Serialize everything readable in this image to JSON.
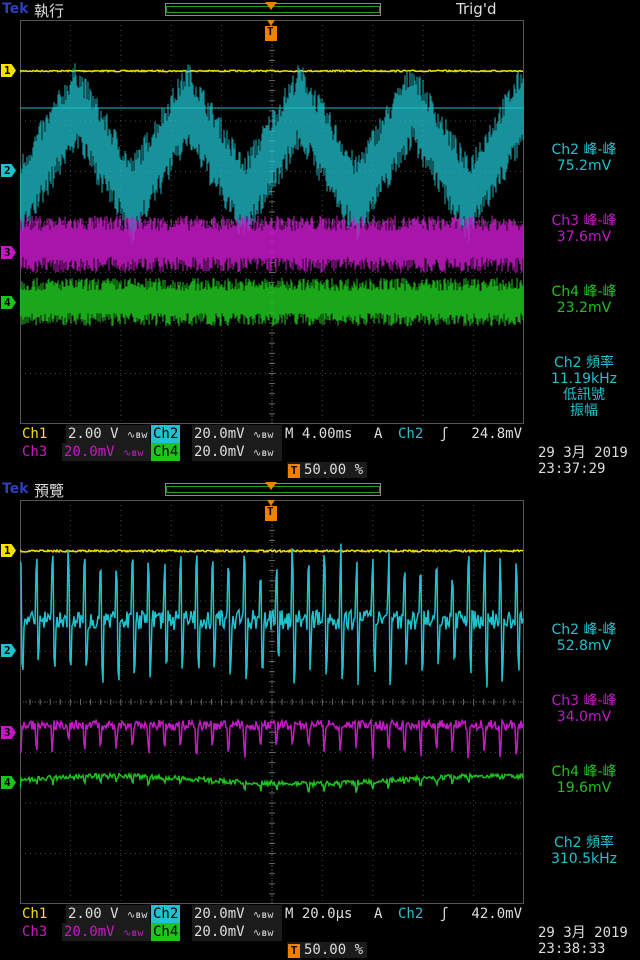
{
  "panels": [
    {
      "brand": "Tek",
      "mode": "執行",
      "trigger_status": "Trig'd",
      "channel_markers": [
        "1",
        "2",
        "3",
        "4"
      ],
      "trigger_marker": "T",
      "measurements": [
        {
          "label": "Ch2 峰-峰",
          "value": "75.2mV",
          "color": "#1fc3cf"
        },
        {
          "label": "Ch3 峰-峰",
          "value": "37.6mV",
          "color": "#c41ac6"
        },
        {
          "label": "Ch4 峰-峰",
          "value": "23.2mV",
          "color": "#1ec41e"
        },
        {
          "label": "Ch2 頻率",
          "value": "11.19kHz",
          "note1": "低訊號",
          "note2": "振幅",
          "color": "#1fc3cf"
        }
      ],
      "settings": {
        "ch1_label": "Ch1",
        "ch1_scale": "2.00 V",
        "ch2_label": "Ch2",
        "ch2_scale": "20.0mV",
        "ch3_label": "Ch3",
        "ch3_scale": "20.0mV",
        "ch4_label": "Ch4",
        "ch4_scale": "20.0mV",
        "bw_symbol": "∿ʙw",
        "timebase": "M 4.00ms",
        "acq": "A",
        "trig_source": "Ch2",
        "trig_slope": "ʃ",
        "trig_level": "24.8mV",
        "trig_position": "50.00 %"
      },
      "date": "29 3月  2019",
      "time": "23:37:29",
      "waveform": {
        "ch2_shape": "triangle-noisy",
        "ch2_cycles": 4.5,
        "ch2_freq_text": "11.19kHz"
      }
    },
    {
      "brand": "Tek",
      "mode": "預覽",
      "trigger_status": "",
      "channel_markers": [
        "1",
        "2",
        "3",
        "4"
      ],
      "trigger_marker": "T",
      "measurements": [
        {
          "label": "Ch2 峰-峰",
          "value": "52.8mV",
          "color": "#1fc3cf"
        },
        {
          "label": "Ch3 峰-峰",
          "value": "34.0mV",
          "color": "#c41ac6"
        },
        {
          "label": "Ch4 峰-峰",
          "value": "19.6mV",
          "color": "#1ec41e"
        },
        {
          "label": "Ch2 頻率",
          "value": "310.5kHz",
          "color": "#1fc3cf"
        }
      ],
      "settings": {
        "ch1_label": "Ch1",
        "ch1_scale": "2.00 V",
        "ch2_label": "Ch2",
        "ch2_scale": "20.0mV",
        "ch3_label": "Ch3",
        "ch3_scale": "20.0mV",
        "ch4_label": "Ch4",
        "ch4_scale": "20.0mV",
        "bw_symbol": "∿ʙw",
        "timebase": "M 20.0µs",
        "acq": "A",
        "trig_source": "Ch2",
        "trig_slope": "ʃ",
        "trig_level": "42.0mV",
        "trig_position": "50.00 %"
      },
      "date": "29 3月  2019",
      "time": "23:38:33",
      "waveform": {
        "ch2_shape": "spiky"
      }
    }
  ],
  "colors": {
    "ch1": "#f5e000",
    "ch2": "#1fc3cf",
    "ch3": "#c41ac6",
    "ch4": "#1ec41e",
    "trigger": "#f08000"
  }
}
